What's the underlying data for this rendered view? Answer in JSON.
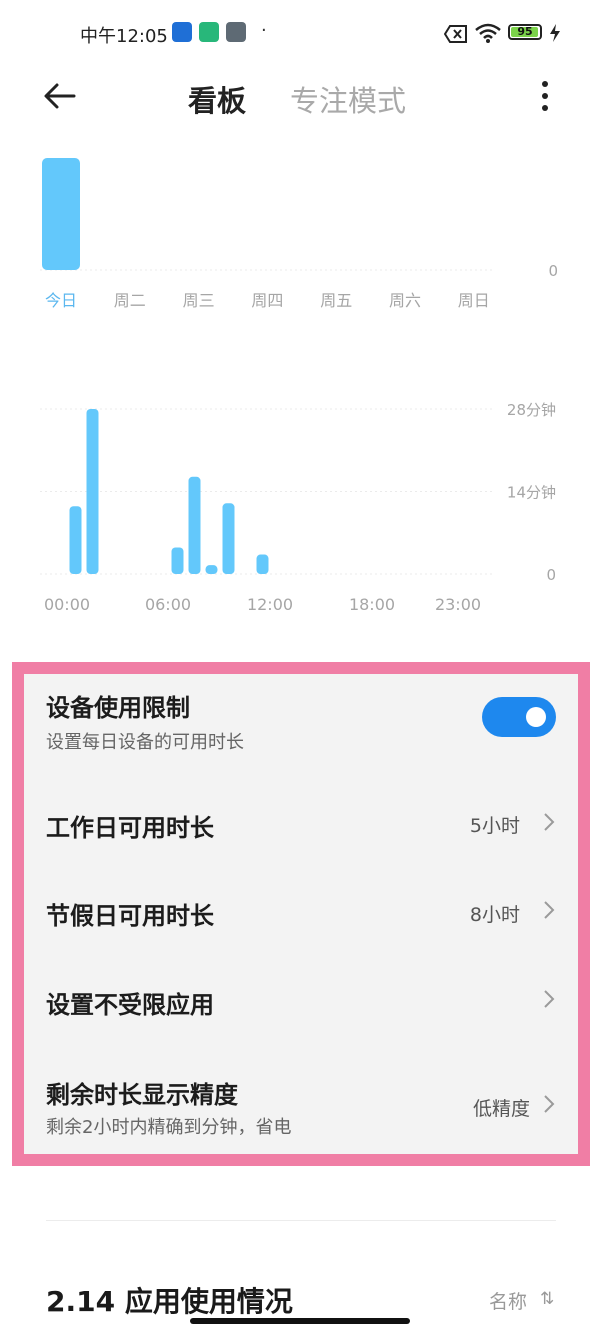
{
  "status_bar": {
    "time": "中午12:05",
    "battery": "95",
    "battery_level": 0.95,
    "icons": [
      "zhihu-app-icon",
      "green-app-icon",
      "gray-app-icon",
      "notification-dot",
      "no-sim-icon",
      "wifi-icon",
      "battery-icon",
      "charging-icon"
    ]
  },
  "header": {
    "tab_dashboard": "看板",
    "tab_focus": "专注模式",
    "back_icon": "arrow-left-icon",
    "more_icon": "more-vertical-icon"
  },
  "colors": {
    "bar": "#63c8fb",
    "accent": "#1e88ee",
    "highlight_border": "#f07ea5",
    "card_bg": "#f3f3f3",
    "axis_label": "#a6a6a6",
    "axis_label_active": "#5bb7ef"
  },
  "chart_data": [
    {
      "type": "bar",
      "categories": [
        "今日",
        "周二",
        "周三",
        "周四",
        "周五",
        "周六",
        "周日"
      ],
      "values": [
        1,
        0,
        0,
        0,
        0,
        0,
        0
      ],
      "y_tick_labels": [
        "0"
      ],
      "active_category": "今日",
      "grid": true
    },
    {
      "type": "bar",
      "x_labels": [
        "00:00",
        "06:00",
        "12:00",
        "18:00",
        "23:00"
      ],
      "y_tick_labels": [
        "28分钟",
        "14分钟",
        "0"
      ],
      "ylim": [
        0,
        28
      ],
      "x_range": [
        0,
        24
      ],
      "bars": [
        {
          "hour": 0.5,
          "minutes": 11.5
        },
        {
          "hour": 1.5,
          "minutes": 28
        },
        {
          "hour": 6.5,
          "minutes": 4.5
        },
        {
          "hour": 7.5,
          "minutes": 16.5
        },
        {
          "hour": 8.5,
          "minutes": 1.5
        },
        {
          "hour": 9.5,
          "minutes": 12
        },
        {
          "hour": 11.5,
          "minutes": 3.3
        }
      ],
      "grid": true
    }
  ],
  "settings": {
    "device_limit": {
      "title": "设备使用限制",
      "subtitle": "设置每日设备的可用时长",
      "enabled": true
    },
    "workday": {
      "title": "工作日可用时长",
      "value": "5小时"
    },
    "holiday": {
      "title": "节假日可用时长",
      "value": "8小时"
    },
    "unrestricted_apps": {
      "title": "设置不受限应用"
    },
    "precision": {
      "title": "剩余时长显示精度",
      "subtitle": "剩余2小时内精确到分钟，省电",
      "value": "低精度"
    }
  },
  "app_usage": {
    "title": "2.14 应用使用情况",
    "sort_label": "名称",
    "sort_icon": "⇅"
  }
}
